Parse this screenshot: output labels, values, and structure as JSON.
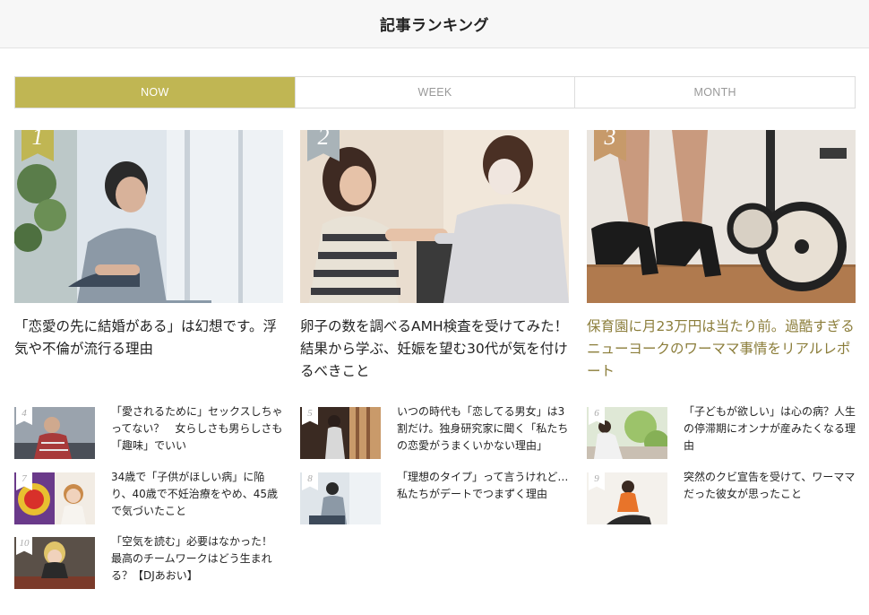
{
  "header": {
    "title": "記事ランキング"
  },
  "tabs": [
    {
      "label": "NOW",
      "active": true
    },
    {
      "label": "WEEK",
      "active": false
    },
    {
      "label": "MONTH",
      "active": false
    }
  ],
  "featured": [
    {
      "rank": "1",
      "title": "「恋愛の先に結婚がある」は幻想です。浮気や不倫が流行る理由",
      "badge_color": "#c0b653"
    },
    {
      "rank": "2",
      "title": "卵子の数を調べるAMH検査を受けてみた！　結果から学ぶ、妊娠を望む30代が気を付けるべきこと",
      "badge_color": "#a9b3b8"
    },
    {
      "rank": "3",
      "title": "保育園に月23万円は当たり前。過酷すぎるニューヨークのワーママ事情をリアルレポート",
      "badge_color": "#c79a6a"
    }
  ],
  "list": [
    {
      "rank": "4",
      "title": "「愛されるために」セックスしちゃってない？　女らしさも男らしさも「趣味」でいい"
    },
    {
      "rank": "5",
      "title": "いつの時代も「恋してる男女」は3割だけ。独身研究家に聞く「私たちの恋愛がうまくいかない理由」"
    },
    {
      "rank": "6",
      "title": "「子どもが欲しい」は心の病？人生の停滞期にオンナが産みたくなる理由"
    },
    {
      "rank": "7",
      "title": "34歳で「子供がほしい病」に陥り、40歳で不妊治療をやめ、45歳で気づいたこと"
    },
    {
      "rank": "8",
      "title": "「理想のタイプ」って言うけれど…私たちがデートでつまずく理由"
    },
    {
      "rank": "9",
      "title": "突然のクビ宣告を受けて、ワーママだった彼女が思ったこと"
    },
    {
      "rank": "10",
      "title": "「空気を読む」必要はなかった！　最高のチームワークはどう生まれる？【DJあおい】"
    }
  ]
}
